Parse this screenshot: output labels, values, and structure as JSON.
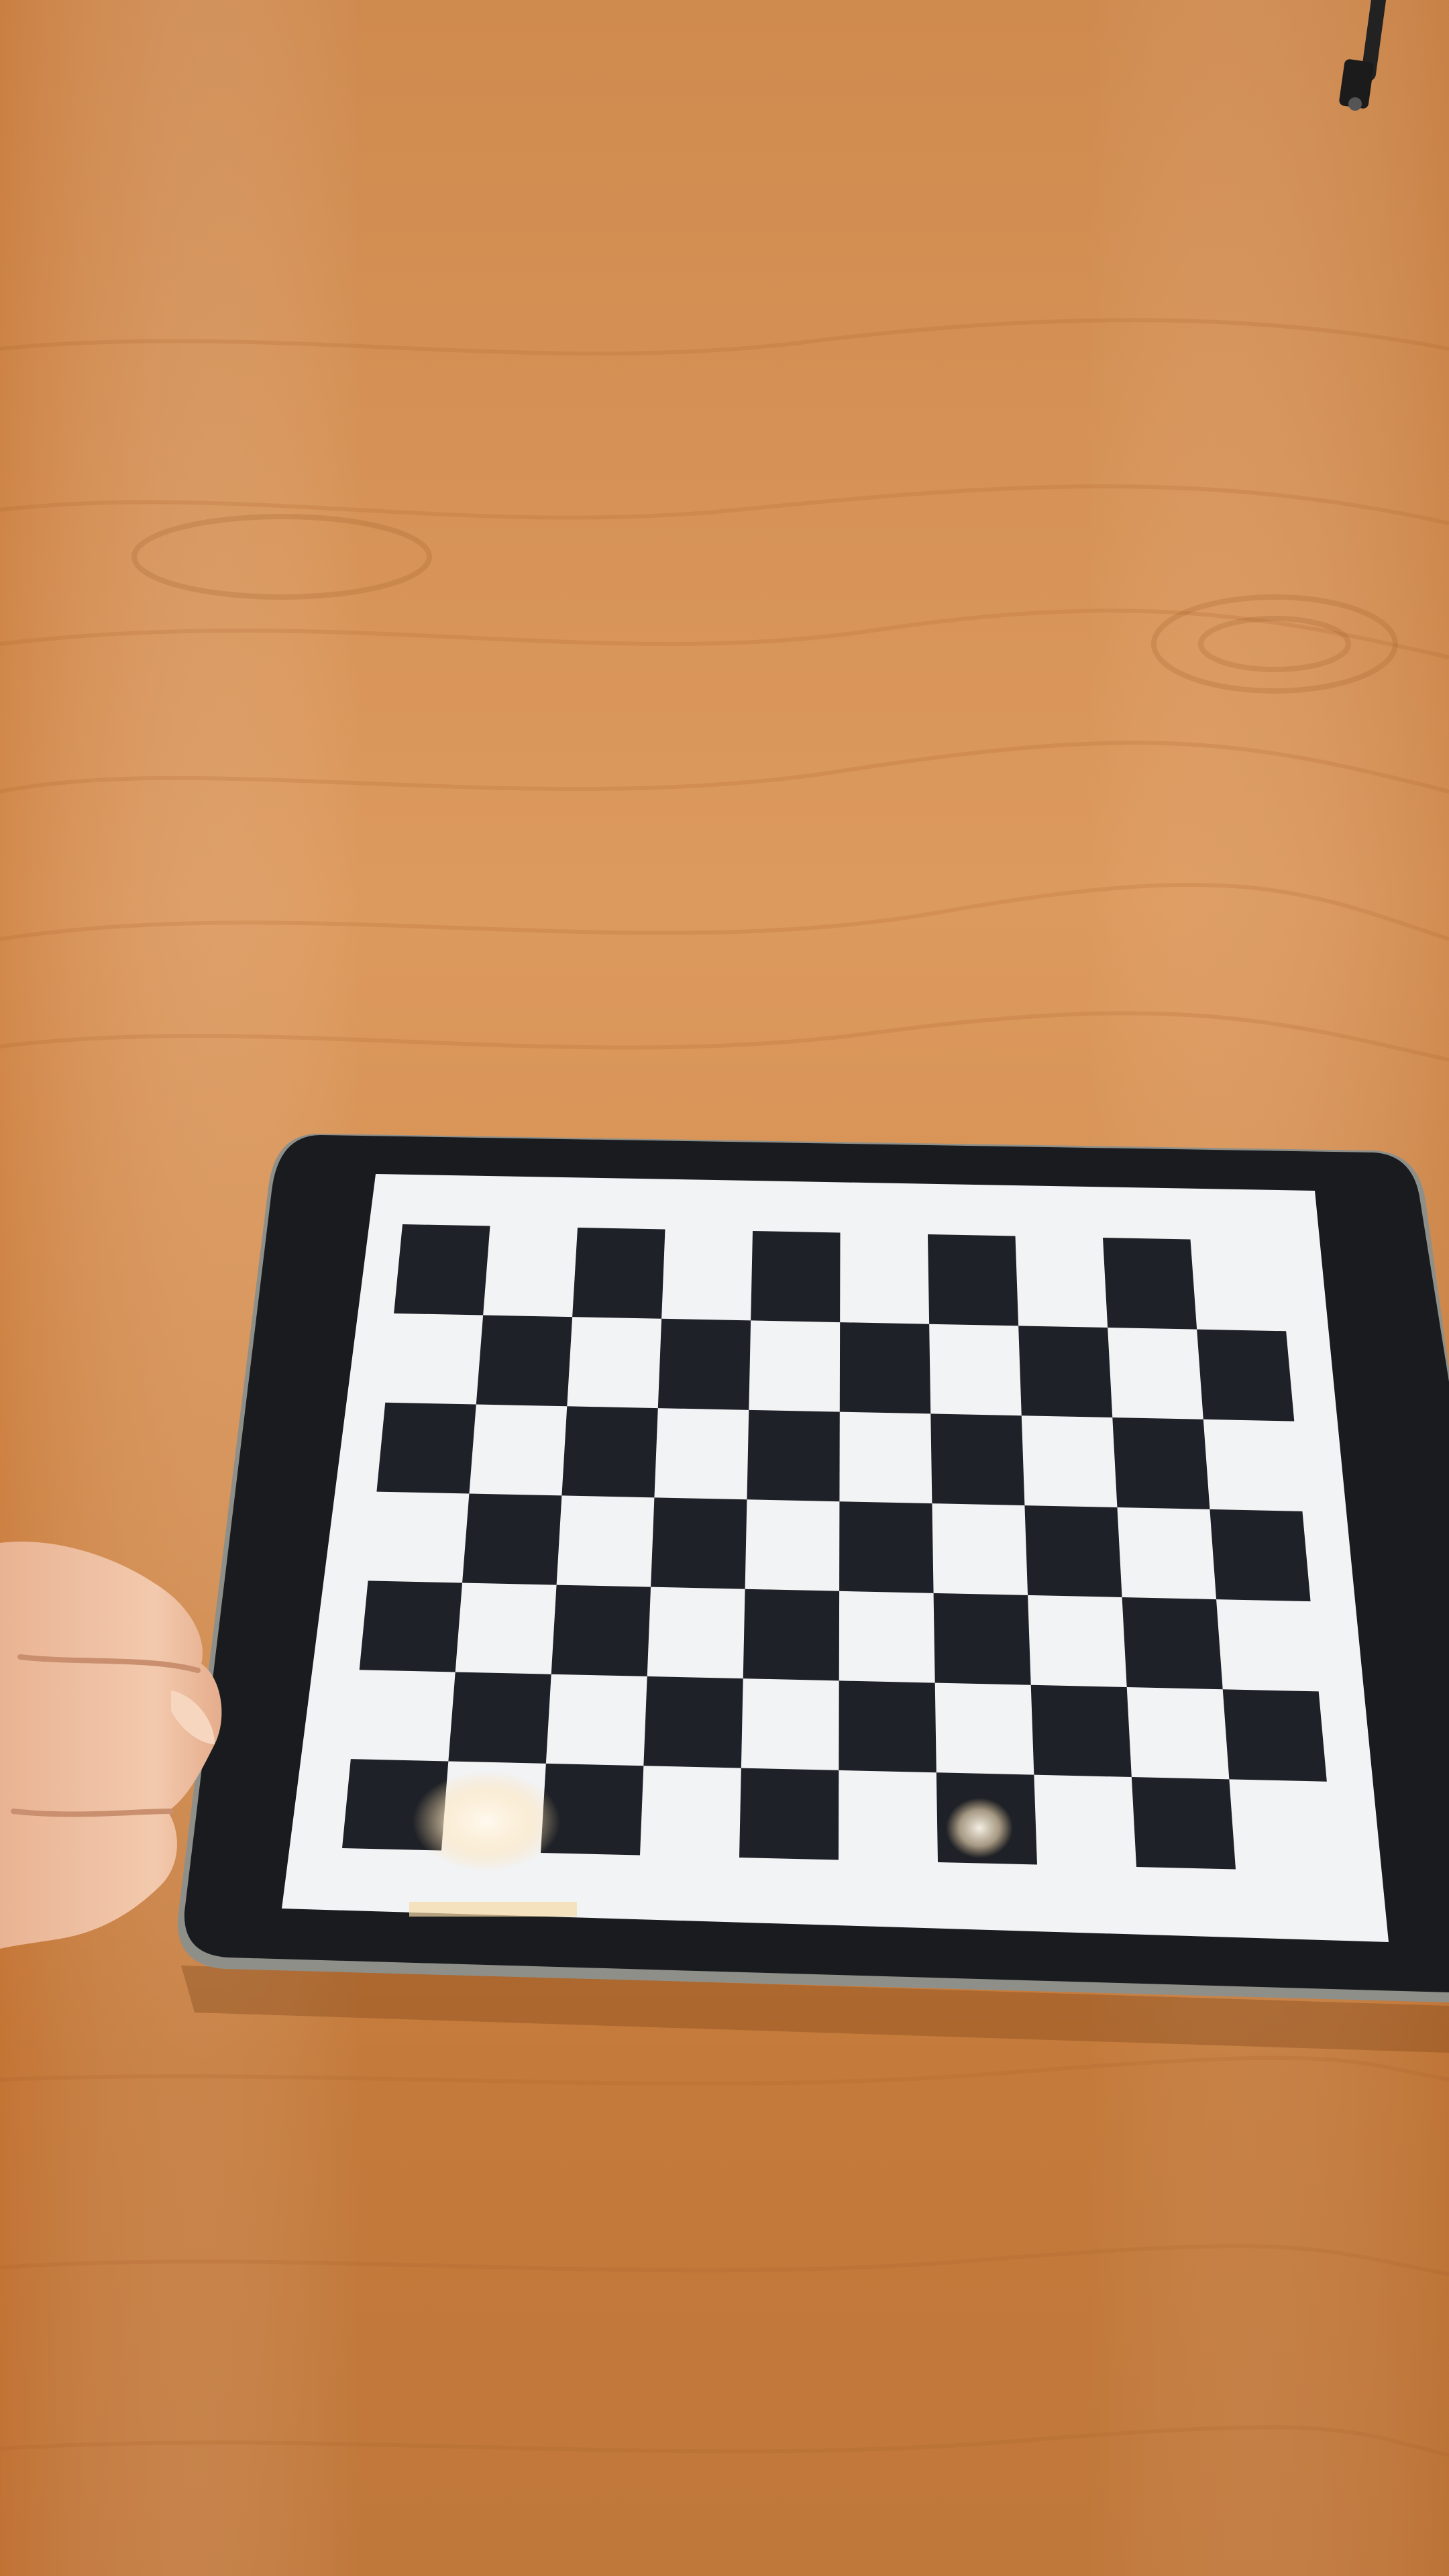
{
  "scene": {
    "colors": {
      "wood_light": "#d9955a",
      "wood_mid": "#c9803f",
      "wood_dark": "#b86a2c",
      "wood_grain": "#a85f28",
      "tablet_frame": "#1a1b1e",
      "tablet_edge": "#8a8a86",
      "screen_white": "#f2f3f5",
      "checker_dark": "#1e2127",
      "skin_light": "#f0c4a4",
      "skin_shadow": "#c98f6e",
      "glare": "#fff2d6",
      "cable": "#222222"
    },
    "icons": {
      "cable": "cable-icon"
    },
    "checkerboard": {
      "columns": 10,
      "rows": 7,
      "dark_square_parity": 0
    }
  }
}
